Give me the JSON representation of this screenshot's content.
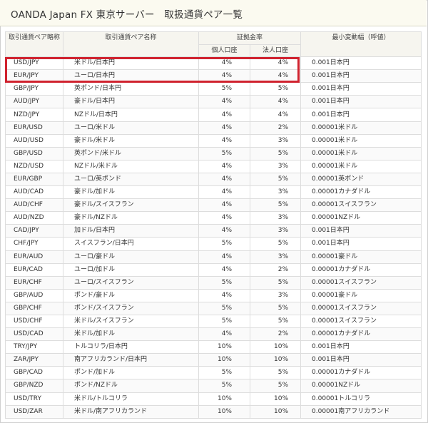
{
  "title": "OANDA Japan FX 東京サーバー　取扱通貨ペア一覧",
  "headers": {
    "code": "取引通貨ペア略称",
    "name": "取引通貨ペア名称",
    "margin": "証拠金率",
    "individual": "個人口座",
    "corporate": "法人口座",
    "min_tick": "最小変動幅（呼値）"
  },
  "highlight_color": "#d0222e",
  "rows": [
    {
      "code": "USD/JPY",
      "name": "米ドル/日本円",
      "individual": "4%",
      "corporate": "4%",
      "tick": "0.001日本円"
    },
    {
      "code": "EUR/JPY",
      "name": "ユーロ/日本円",
      "individual": "4%",
      "corporate": "4%",
      "tick": "0.001日本円"
    },
    {
      "code": "GBP/JPY",
      "name": "英ポンド/日本円",
      "individual": "5%",
      "corporate": "5%",
      "tick": "0.001日本円"
    },
    {
      "code": "AUD/JPY",
      "name": "豪ドル/日本円",
      "individual": "4%",
      "corporate": "4%",
      "tick": "0.001日本円"
    },
    {
      "code": "NZD/JPY",
      "name": "NZドル/日本円",
      "individual": "4%",
      "corporate": "4%",
      "tick": "0.001日本円"
    },
    {
      "code": "EUR/USD",
      "name": "ユーロ/米ドル",
      "individual": "4%",
      "corporate": "2%",
      "tick": "0.00001米ドル"
    },
    {
      "code": "AUD/USD",
      "name": "豪ドル/米ドル",
      "individual": "4%",
      "corporate": "3%",
      "tick": "0.00001米ドル"
    },
    {
      "code": "GBP/USD",
      "name": "英ポンド/米ドル",
      "individual": "5%",
      "corporate": "5%",
      "tick": "0.00001米ドル"
    },
    {
      "code": "NZD/USD",
      "name": "NZドル/米ドル",
      "individual": "4%",
      "corporate": "3%",
      "tick": "0.00001米ドル"
    },
    {
      "code": "EUR/GBP",
      "name": "ユーロ/英ポンド",
      "individual": "4%",
      "corporate": "5%",
      "tick": "0.00001英ポンド"
    },
    {
      "code": "AUD/CAD",
      "name": "豪ドル/加ドル",
      "individual": "4%",
      "corporate": "3%",
      "tick": "0.00001カナダドル"
    },
    {
      "code": "AUD/CHF",
      "name": "豪ドル/スイスフラン",
      "individual": "4%",
      "corporate": "5%",
      "tick": "0.00001スイスフラン"
    },
    {
      "code": "AUD/NZD",
      "name": "豪ドル/NZドル",
      "individual": "4%",
      "corporate": "3%",
      "tick": "0.00001NZドル"
    },
    {
      "code": "CAD/JPY",
      "name": "加ドル/日本円",
      "individual": "4%",
      "corporate": "3%",
      "tick": "0.001日本円"
    },
    {
      "code": "CHF/JPY",
      "name": "スイスフラン/日本円",
      "individual": "5%",
      "corporate": "5%",
      "tick": "0.001日本円"
    },
    {
      "code": "EUR/AUD",
      "name": "ユーロ/豪ドル",
      "individual": "4%",
      "corporate": "3%",
      "tick": "0.00001豪ドル"
    },
    {
      "code": "EUR/CAD",
      "name": "ユーロ/加ドル",
      "individual": "4%",
      "corporate": "2%",
      "tick": "0.00001カナダドル"
    },
    {
      "code": "EUR/CHF",
      "name": "ユーロ/スイスフラン",
      "individual": "5%",
      "corporate": "5%",
      "tick": "0.00001スイスフラン"
    },
    {
      "code": "GBP/AUD",
      "name": "ポンド/豪ドル",
      "individual": "4%",
      "corporate": "3%",
      "tick": "0.00001豪ドル"
    },
    {
      "code": "GBP/CHF",
      "name": "ポンド/スイスフラン",
      "individual": "5%",
      "corporate": "5%",
      "tick": "0.00001スイスフラン"
    },
    {
      "code": "USD/CHF",
      "name": "米ドル/スイスフラン",
      "individual": "5%",
      "corporate": "5%",
      "tick": "0.00001スイスフラン"
    },
    {
      "code": "USD/CAD",
      "name": "米ドル/加ドル",
      "individual": "4%",
      "corporate": "2%",
      "tick": "0.00001カナダドル"
    },
    {
      "code": "TRY/JPY",
      "name": "トルコリラ/日本円",
      "individual": "10%",
      "corporate": "10%",
      "tick": "0.001日本円"
    },
    {
      "code": "ZAR/JPY",
      "name": "南アフリカランド/日本円",
      "individual": "10%",
      "corporate": "10%",
      "tick": "0.001日本円"
    },
    {
      "code": "GBP/CAD",
      "name": "ポンド/加ドル",
      "individual": "5%",
      "corporate": "5%",
      "tick": "0.00001カナダドル"
    },
    {
      "code": "GBP/NZD",
      "name": "ポンド/NZドル",
      "individual": "5%",
      "corporate": "5%",
      "tick": "0.00001NZドル"
    },
    {
      "code": "USD/TRY",
      "name": "米ドル/トルコリラ",
      "individual": "10%",
      "corporate": "10%",
      "tick": "0.00001トルコリラ"
    },
    {
      "code": "USD/ZAR",
      "name": "米ドル/南アフリカランド",
      "individual": "10%",
      "corporate": "10%",
      "tick": "0.00001南アフリカランド"
    }
  ]
}
